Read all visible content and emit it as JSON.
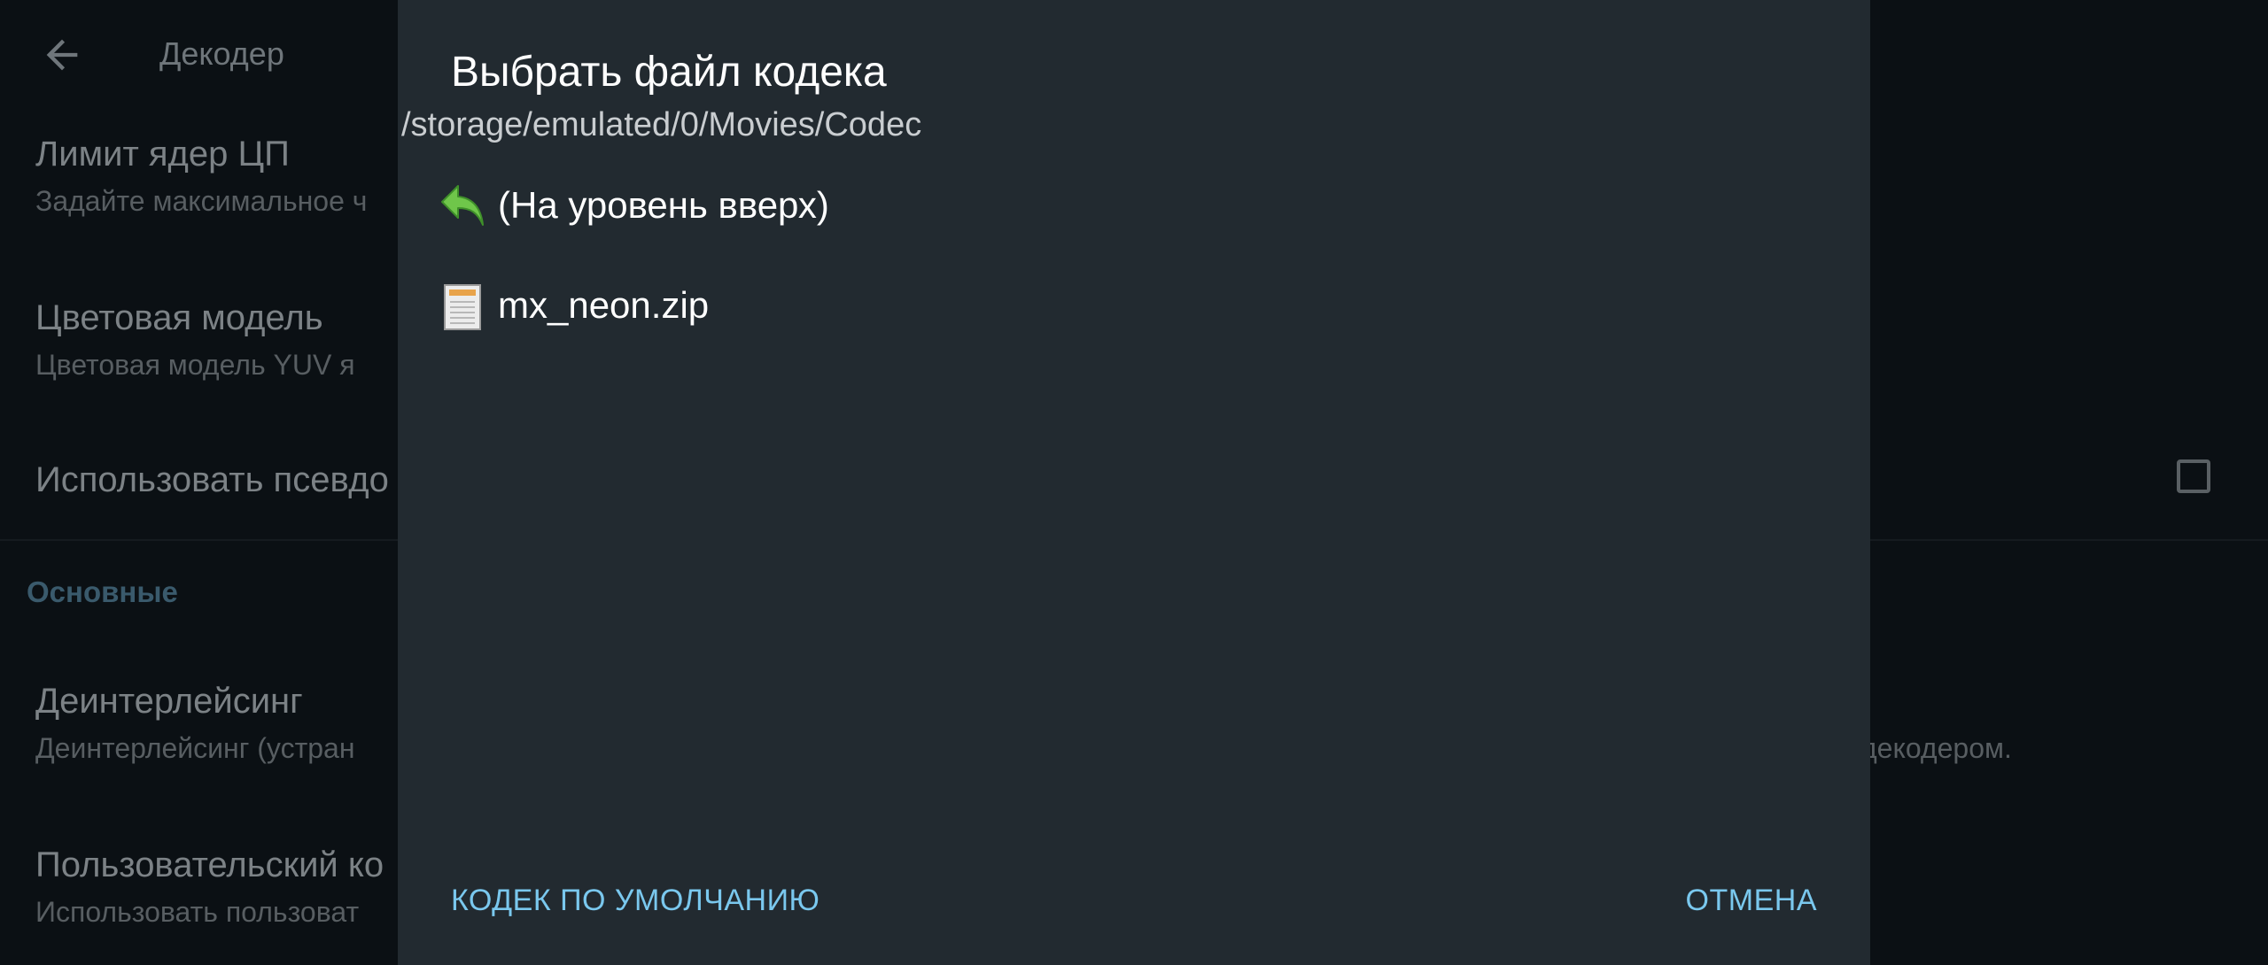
{
  "background": {
    "toolbar_title": "Декодер",
    "preferences": [
      {
        "title": "Лимит ядер ЦП",
        "summary": "Задайте максимальное ч"
      },
      {
        "title": "Цветовая модель",
        "summary": "Цветовая модель YUV я"
      },
      {
        "title": "Использовать псевдо"
      }
    ],
    "section_title": "Основные",
    "preferences_2": [
      {
        "title": "Деинтерлейсинг",
        "summary": "Деинтерлейсинг (устран"
      },
      {
        "title": "Пользовательский ко",
        "summary": "Использовать пользоват"
      }
    ],
    "deinterlace_summary_right": "декодером."
  },
  "dialog": {
    "title": "Выбрать файл кодека",
    "path": "/storage/emulated/0/Movies/Codec",
    "entries": [
      {
        "label": "(На уровень вверх)",
        "icon": "up-arrow-icon"
      },
      {
        "label": "mx_neon.zip",
        "icon": "zip-file-icon"
      }
    ],
    "default_button": "КОДЕК ПО УМОЛЧАНИЮ",
    "cancel_button": "ОТМЕНА"
  },
  "colors": {
    "accent": "#7ac8ee",
    "dialog_bg": "#222a30",
    "screen_bg": "#0b1014"
  }
}
